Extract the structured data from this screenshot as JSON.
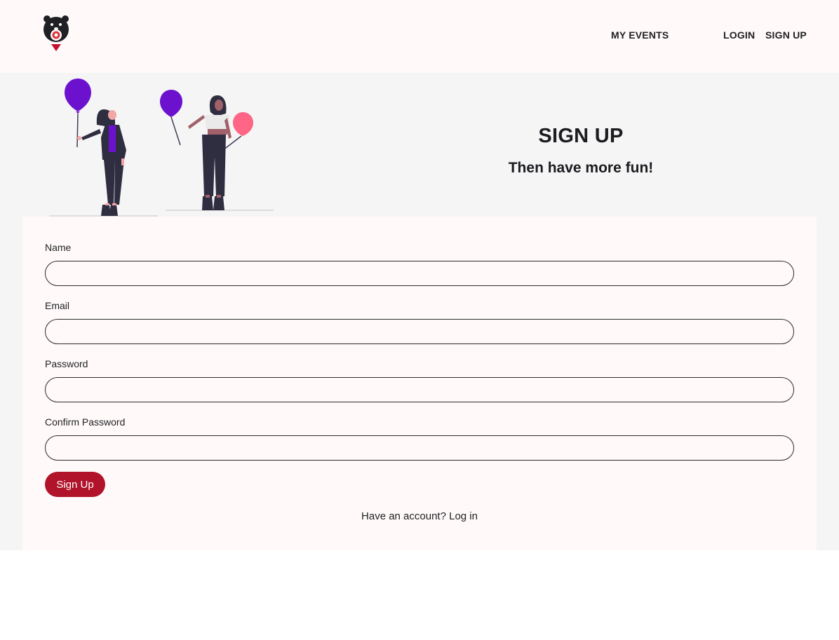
{
  "nav": {
    "my_events": "MY EVENTS",
    "login": "LOGIN",
    "signup": "SIGN UP"
  },
  "hero": {
    "title": "SIGN UP",
    "subtitle": "Then have more fun!"
  },
  "form": {
    "name_label": "Name",
    "email_label": "Email",
    "password_label": "Password",
    "confirm_label": "Confirm Password",
    "name_value": "",
    "email_value": "",
    "password_value": "",
    "confirm_value": "",
    "submit_label": "Sign Up"
  },
  "footer_prompt": {
    "text": "Have an account?",
    "link": "Log in"
  },
  "colors": {
    "primary": "#b0132a",
    "balloon_purple": "#6c12cf",
    "balloon_pink": "#ff6584",
    "background_light": "#fffaf9",
    "hero_background": "#f5f5f5"
  },
  "icons": {
    "logo": "bear-logo-icon"
  }
}
